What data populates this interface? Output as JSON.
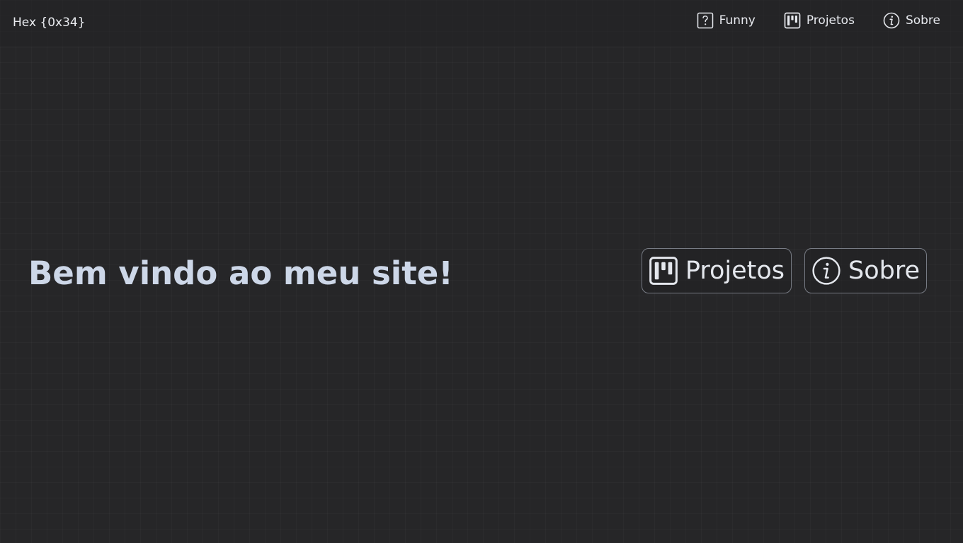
{
  "header": {
    "brand": "Hex {0x34}",
    "nav": [
      {
        "label": "Funny",
        "icon": "question-square-icon"
      },
      {
        "label": "Projetos",
        "icon": "kanban-icon"
      },
      {
        "label": "Sobre",
        "icon": "info-circle-icon"
      }
    ]
  },
  "main": {
    "title": "Bem vindo ao meu site!",
    "buttons": [
      {
        "label": "Projetos",
        "icon": "kanban-icon"
      },
      {
        "label": "Sobre",
        "icon": "info-circle-icon"
      }
    ]
  },
  "colors": {
    "background": "#262628",
    "text": "#e6e8ee",
    "title": "#cdd7e8",
    "button_border": "#777b84"
  }
}
